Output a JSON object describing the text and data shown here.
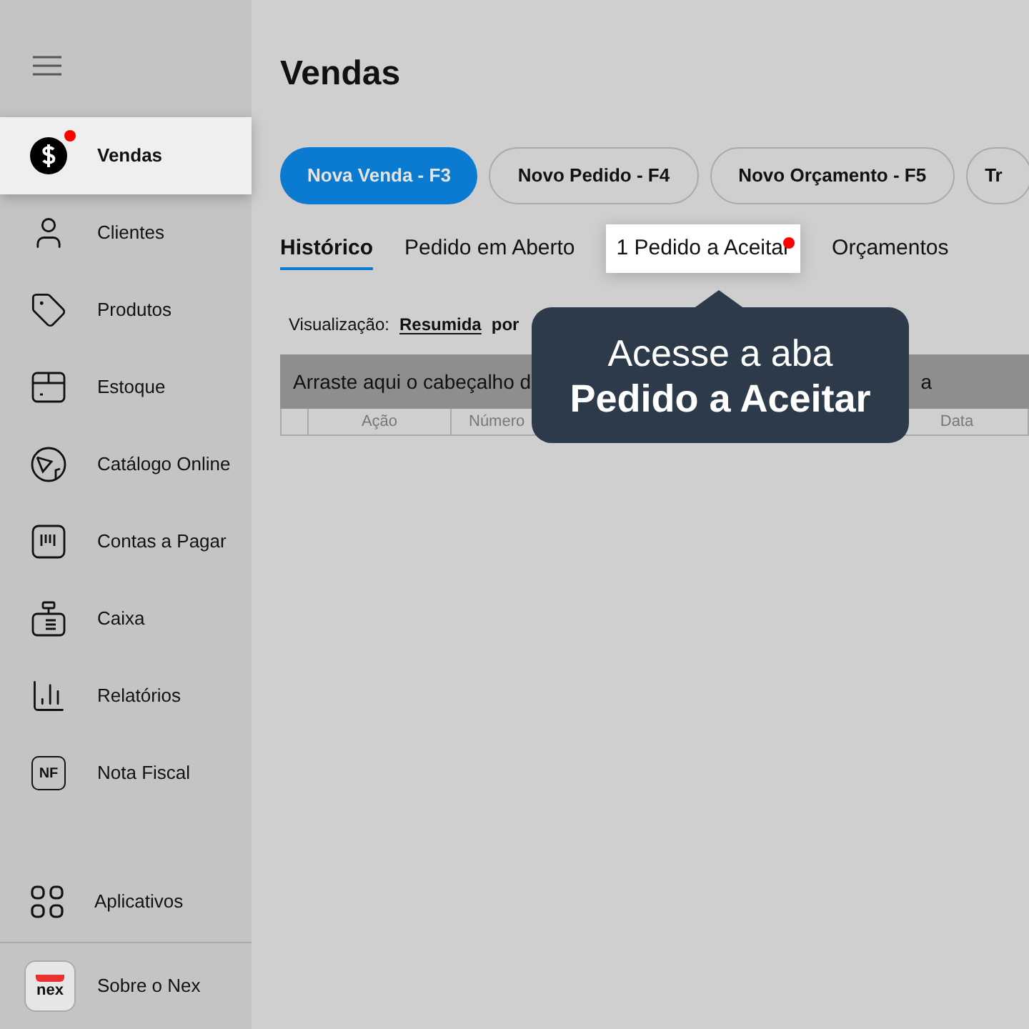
{
  "sidebar": {
    "items": [
      {
        "label": "Vendas",
        "kind": "dollar",
        "selected": true,
        "notification": true
      },
      {
        "label": "Clientes",
        "kind": "user",
        "selected": false,
        "notification": false
      },
      {
        "label": "Produtos",
        "kind": "tag",
        "selected": false,
        "notification": false
      },
      {
        "label": "Estoque",
        "kind": "box",
        "selected": false,
        "notification": false
      },
      {
        "label": "Catálogo Online",
        "kind": "catalog",
        "selected": false,
        "notification": false
      },
      {
        "label": "Contas a Pagar",
        "kind": "bill",
        "selected": false,
        "notification": false
      },
      {
        "label": "Caixa",
        "kind": "register",
        "selected": false,
        "notification": false
      },
      {
        "label": "Relatórios",
        "kind": "bars",
        "selected": false,
        "notification": false
      },
      {
        "label": "Nota Fiscal",
        "kind": "nf",
        "icon_text": "NF",
        "selected": false,
        "notification": false
      }
    ],
    "bottom_items": [
      {
        "label": "Aplicativos",
        "kind": "apps"
      },
      {
        "label": "Sobre o Nex",
        "kind": "logo",
        "icon_text": "nex"
      }
    ]
  },
  "page": {
    "title": "Vendas"
  },
  "actions": [
    {
      "label": "Nova Venda - F3",
      "primary": true
    },
    {
      "label": "Novo Pedido - F4",
      "primary": false
    },
    {
      "label": "Novo Orçamento - F5",
      "primary": false
    },
    {
      "label": "Tr",
      "primary": false
    }
  ],
  "tabs": [
    {
      "label": "Histórico",
      "selected": true,
      "highlighted": false,
      "notification": false
    },
    {
      "label": "Pedido em Aberto",
      "selected": false,
      "highlighted": false,
      "notification": false
    },
    {
      "label": "1 Pedido a Aceitar",
      "selected": false,
      "highlighted": true,
      "notification": true
    },
    {
      "label": "Orçamentos",
      "selected": false,
      "highlighted": false,
      "notification": false
    }
  ],
  "view": {
    "label": "Visualização:",
    "options": [
      {
        "label": "Resumida",
        "selected": true
      },
      {
        "label": "por",
        "selected": false
      }
    ]
  },
  "grid": {
    "group_panel": [
      "Arraste aqui o cabeçalho d",
      "a"
    ],
    "columns": [
      "",
      "Ação",
      "Número",
      "",
      "",
      "Data"
    ]
  },
  "tooltip": {
    "line_1": "Acesse a aba",
    "line_2": "Pedido a Aceitar"
  }
}
